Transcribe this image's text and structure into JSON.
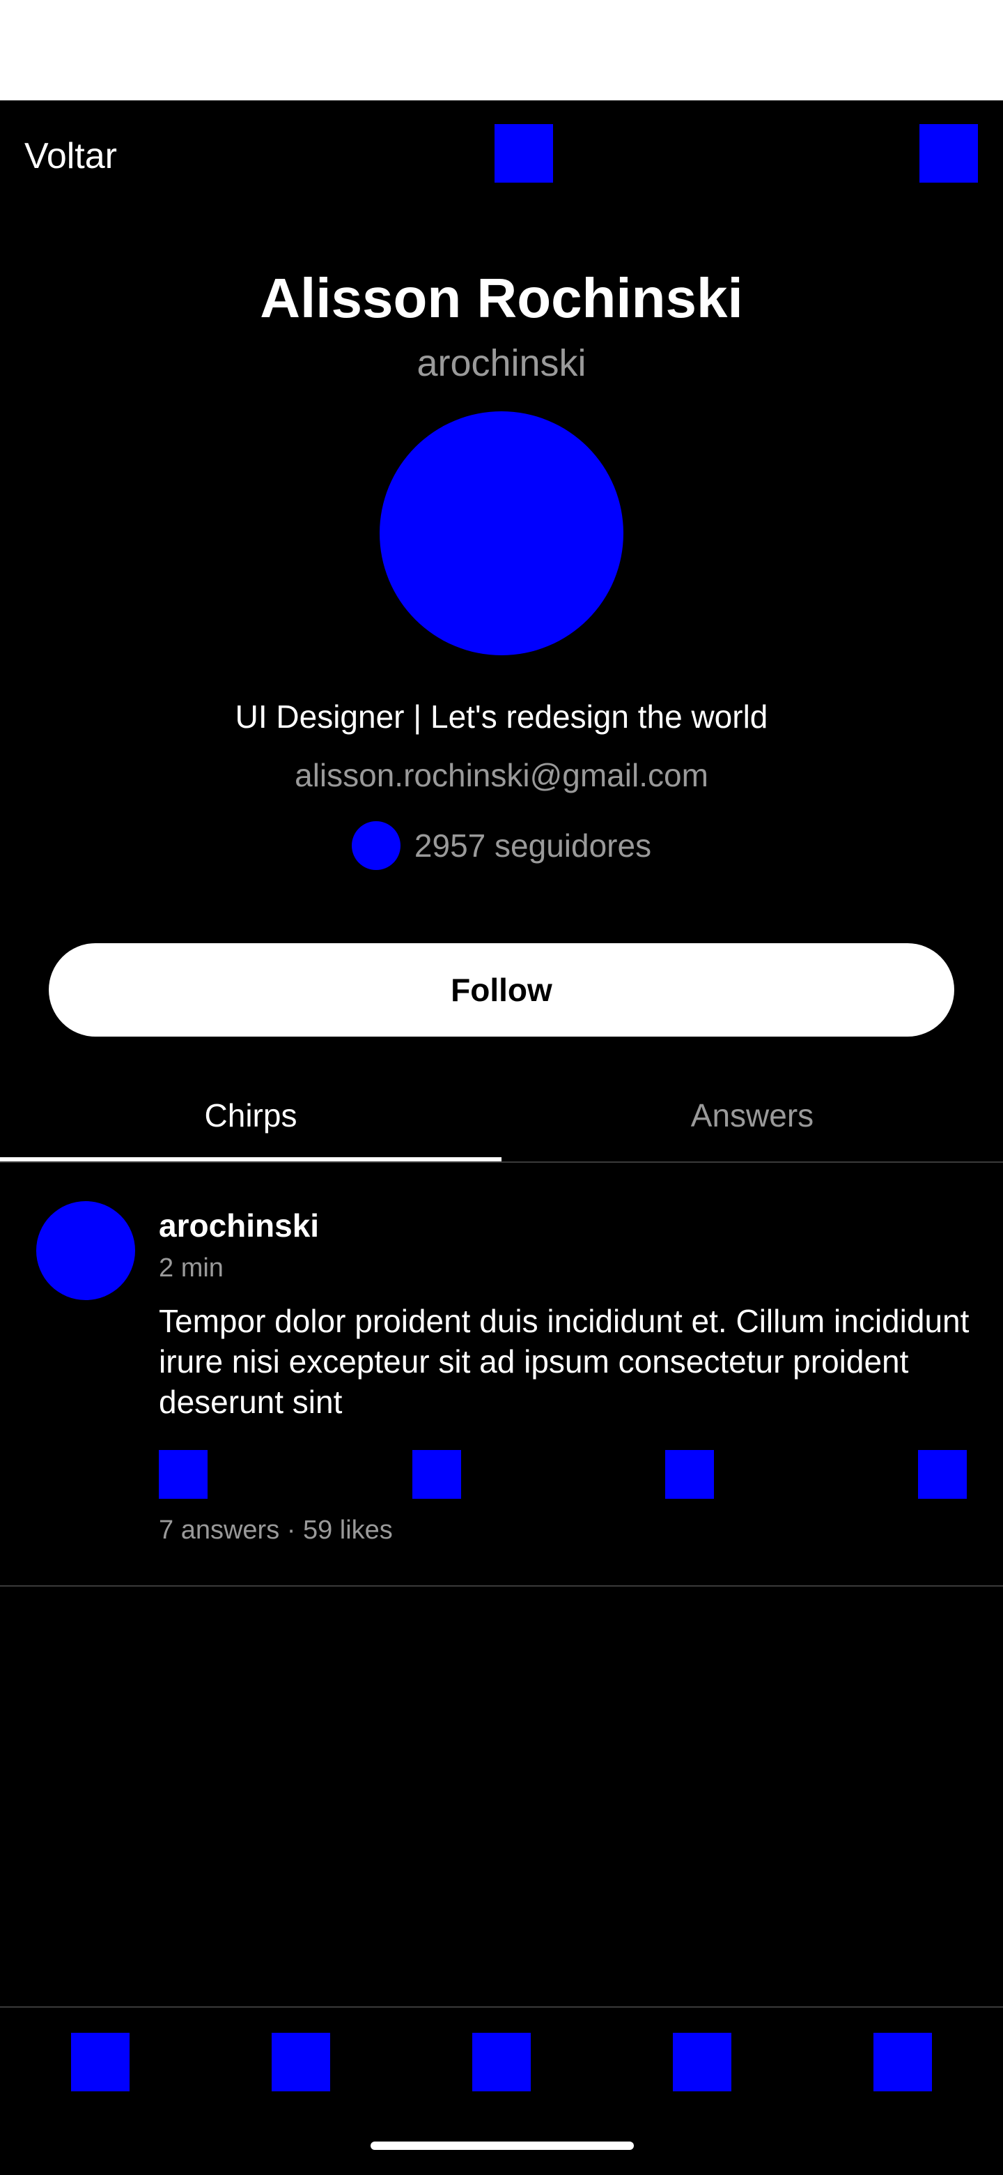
{
  "header": {
    "back_label": "Voltar",
    "logo_icon": "logo-icon",
    "menu_icon": "menu-icon"
  },
  "profile": {
    "name": "Alisson Rochinski",
    "handle": "arochinski",
    "bio": "UI Designer | Let's redesign the world",
    "email": "alisson.rochinski@gmail.com",
    "followers_icon": "followers-icon",
    "followers_text": "2957 seguidores"
  },
  "follow_button": {
    "label": "Follow"
  },
  "tabs": [
    {
      "label": "Chirps",
      "active": true
    },
    {
      "label": "Answers",
      "active": false
    }
  ],
  "posts": [
    {
      "author": "arochinski",
      "time": "2 min",
      "body": "Tempor dolor proident duis incididunt et. Cillum incididunt irure nisi excepteur sit ad ipsum consectetur proident deserunt sint",
      "stats": "7 answers · 59 likes",
      "actions": [
        "reply-icon",
        "rechirp-icon",
        "like-icon",
        "share-icon"
      ]
    }
  ],
  "bottom_nav": {
    "items": [
      "home-icon",
      "search-icon",
      "compose-icon",
      "notifications-icon",
      "messages-icon"
    ]
  },
  "colors": {
    "background": "#000000",
    "placeholder": "#0000ff",
    "primary_text": "#ffffff",
    "secondary_text": "#9a9a9a",
    "divider": "#3a3a3a"
  }
}
